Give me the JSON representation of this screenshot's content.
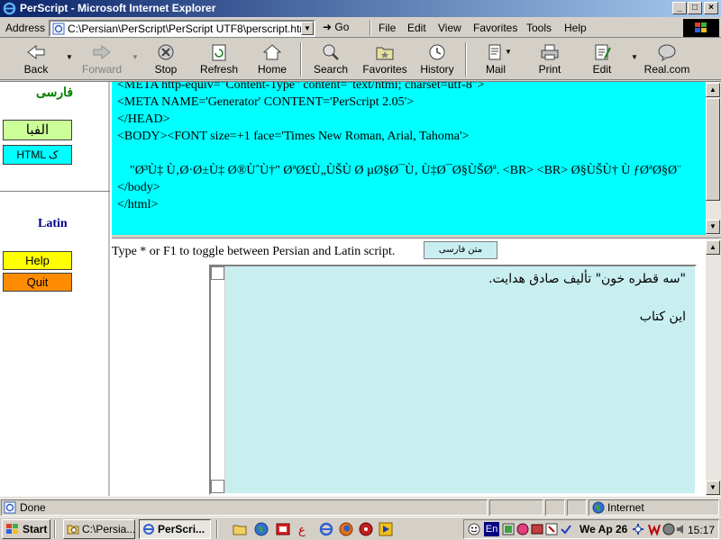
{
  "window": {
    "title": "PerScript - Microsoft Internet Explorer",
    "controls": {
      "minimize": "_",
      "maximize": "□",
      "close": "×"
    }
  },
  "address": {
    "label": "Address",
    "url": "C:\\Persian\\PerScript\\PerScript UTF8\\perscript.htm",
    "go_label": "Go"
  },
  "menu": [
    "File",
    "Edit",
    "View",
    "Favorites",
    "Tools",
    "Help"
  ],
  "toolbar": {
    "back": "Back",
    "forward": "Forward",
    "stop": "Stop",
    "refresh": "Refresh",
    "home": "Home",
    "search": "Search",
    "favorites": "Favorites",
    "history": "History",
    "mail": "Mail",
    "print": "Print",
    "edit": "Edit",
    "real": "Real.com"
  },
  "left_frame": {
    "farsi_heading": "فارسی",
    "alefba_button": "الفبا",
    "html_button": "HTML ک",
    "latin_heading": "Latin",
    "help_button": "Help",
    "quit_button": "Quit"
  },
  "code_frame": {
    "text": "<META http-equiv=\"Content-Type\" content=\"text/html; charset=utf-8\">\n<META NAME='Generator' CONTENT='PerScript 2.05'>\n</HEAD>\n<BODY><FONT size=+1 face='Times New Roman, Arial, Tahoma'>\n\n    \"Ø³Ù‡ Ù‚Ø·Ø±Ù‡ Ø®ÙˆÙ†\" ØªØ£Ù„ÙŠÙ Ø µØ§Ø¯Ù‚ Ù‡Ø¯Ø§ÙŠØª. <BR> <BR> Ø§ÙŠÙ† Ù ƒØªØ§Ø¨\n</body>\n</html>"
  },
  "input_frame": {
    "toggle_hint": "Type * or F1 to toggle between Persian and Latin script.",
    "mode_label": "متن فارسی",
    "lines": [
      "\"سه قطره خون\" تألیف صادق هدایت.",
      "این کتاب"
    ]
  },
  "status": {
    "text": "Done",
    "zone": "Internet"
  },
  "taskbar": {
    "start": "Start",
    "tasks": [
      "C:\\Persia...",
      "PerScri..."
    ],
    "tray_date": "We Ap 26",
    "tray_lang": "En",
    "clock": "15:17"
  }
}
